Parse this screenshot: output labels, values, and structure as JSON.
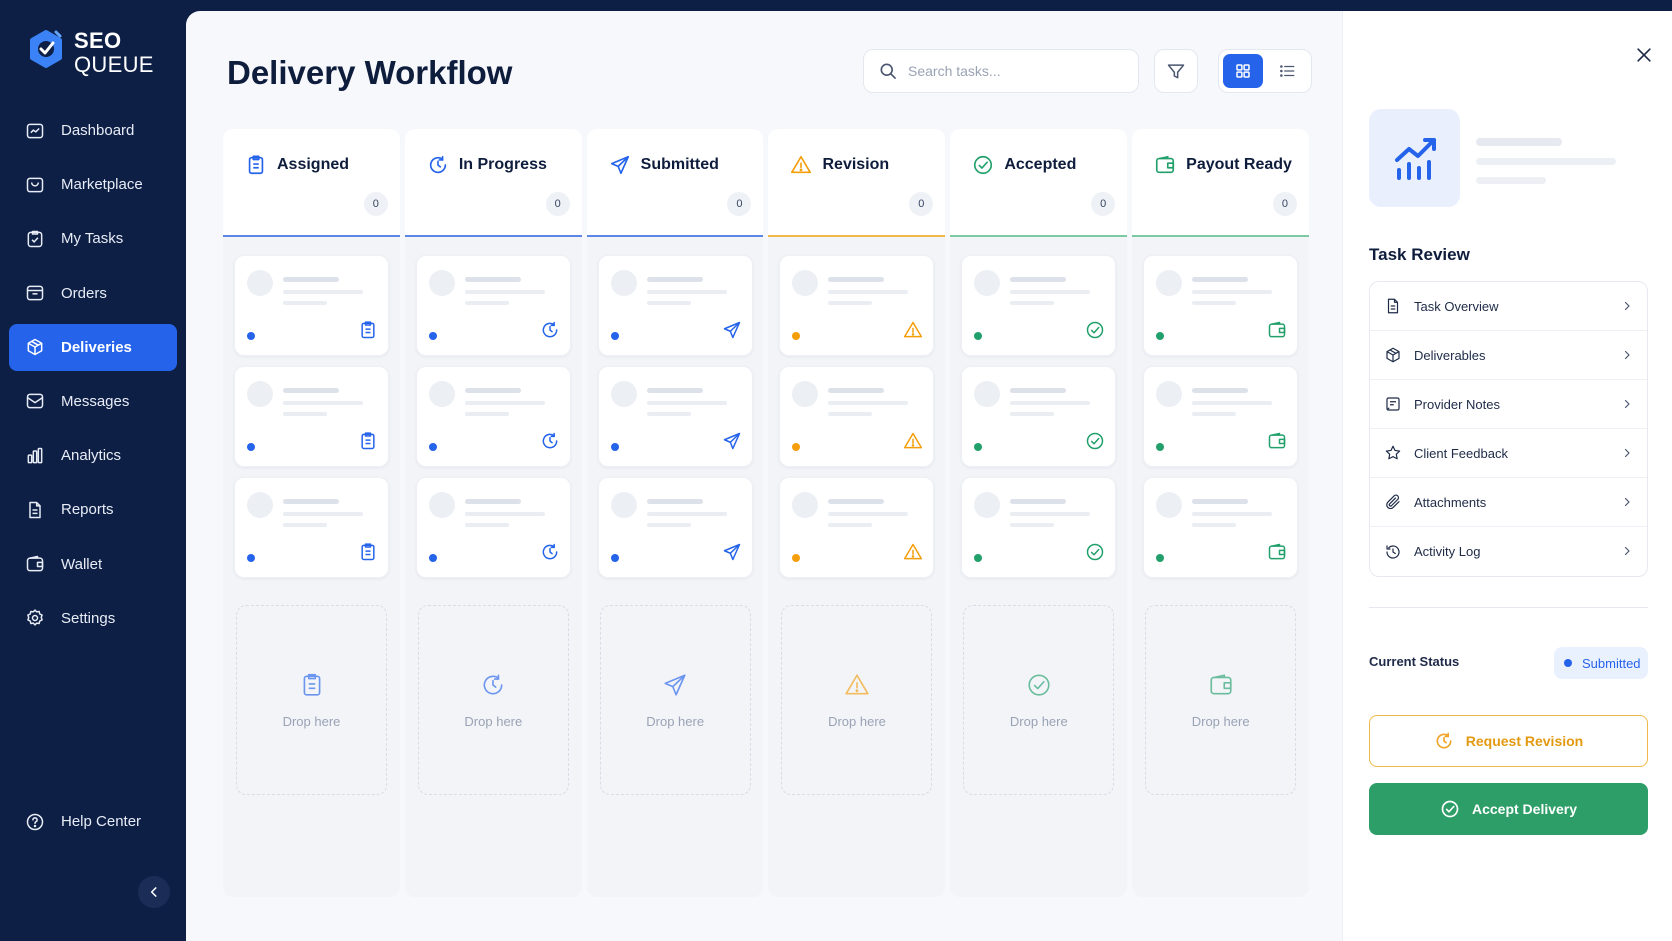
{
  "app": {
    "logo_line1": "SEO",
    "logo_line2": "QUEUE",
    "logo_icon": "seo-queue-logo-icon"
  },
  "sidebar": {
    "items": [
      {
        "label": "Dashboard",
        "icon": "dashboard-icon"
      },
      {
        "label": "Marketplace",
        "icon": "marketplace-icon"
      },
      {
        "label": "My Tasks",
        "icon": "tasks-icon"
      },
      {
        "label": "Orders",
        "icon": "orders-icon"
      },
      {
        "label": "Deliveries",
        "icon": "box-icon",
        "active": true
      },
      {
        "label": "Messages",
        "icon": "message-icon"
      },
      {
        "label": "Analytics",
        "icon": "bar-chart-icon"
      },
      {
        "label": "Reports",
        "icon": "document-icon"
      },
      {
        "label": "Wallet",
        "icon": "wallet-icon"
      },
      {
        "label": "Settings",
        "icon": "gear-icon"
      }
    ],
    "help": {
      "label": "Help Center",
      "icon": "help-icon"
    },
    "collapse_icon": "chevron-left-icon"
  },
  "header": {
    "title": "Delivery Workflow",
    "search_placeholder": "Search tasks...",
    "filter_icon": "filter-icon",
    "view_grid_icon": "grid-icon",
    "view_list_icon": "list-icon"
  },
  "columns": [
    {
      "title": "Assigned",
      "count": "0",
      "icon": "clipboard-icon",
      "color": "#2563eb",
      "drop": "Drop here"
    },
    {
      "title": "In Progress",
      "count": "0",
      "icon": "progress-icon",
      "color": "#2563eb",
      "drop": "Drop here"
    },
    {
      "title": "Submitted",
      "count": "0",
      "icon": "send-icon",
      "color": "#2563eb",
      "drop": "Drop here"
    },
    {
      "title": "Revision",
      "count": "0",
      "icon": "warning-icon",
      "color": "#f59e0b",
      "drop": "Drop here"
    },
    {
      "title": "Accepted",
      "count": "0",
      "icon": "check-circle-icon",
      "color": "#22a06b",
      "drop": "Drop here"
    },
    {
      "title": "Payout Ready",
      "count": "0",
      "icon": "wallet-icon",
      "color": "#22a06b",
      "drop": "Drop here"
    }
  ],
  "panel": {
    "close_icon": "close-icon",
    "thumb_icon": "trending-chart-icon",
    "heading": "Task Review",
    "items": [
      {
        "label": "Task Overview",
        "icon": "document-icon"
      },
      {
        "label": "Deliverables",
        "icon": "package-icon"
      },
      {
        "label": "Provider Notes",
        "icon": "note-icon"
      },
      {
        "label": "Client Feedback",
        "icon": "star-icon"
      },
      {
        "label": "Attachments",
        "icon": "paperclip-icon"
      },
      {
        "label": "Activity Log",
        "icon": "history-icon"
      }
    ],
    "status_label": "Current Status",
    "status_value": "Submitted",
    "revision_button": "Request Revision",
    "accept_button": "Accept Delivery"
  },
  "colors": {
    "accent": "#2563eb",
    "sidebar_bg": "#0d1f45",
    "warning": "#f59e0b",
    "success": "#22a06b",
    "accept_bg": "#2e9e68"
  }
}
